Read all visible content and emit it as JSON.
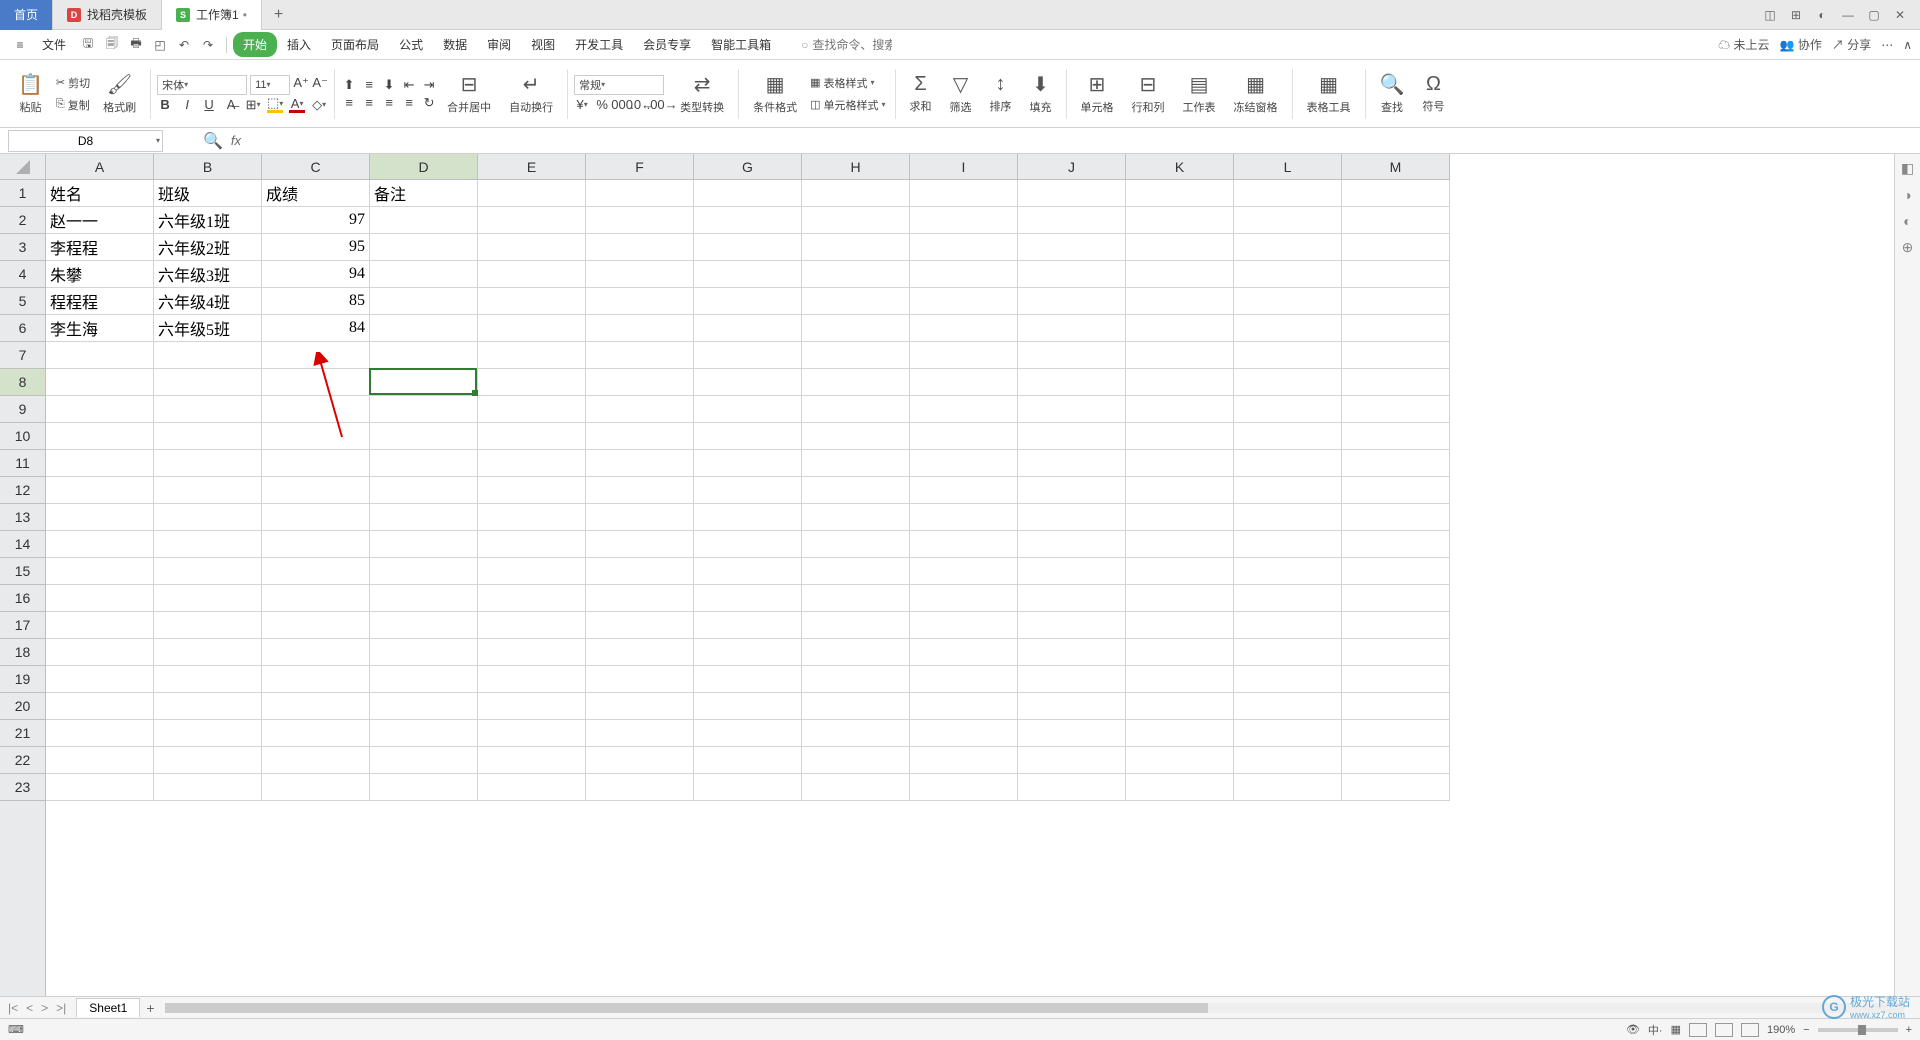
{
  "titlebar": {
    "home_label": "首页",
    "tab1_label": "找稻壳模板",
    "tab2_label": "工作簿1",
    "tab2_modified": "•",
    "add": "+"
  },
  "menubar": {
    "file": "文件",
    "items": [
      "开始",
      "插入",
      "页面布局",
      "公式",
      "数据",
      "审阅",
      "视图",
      "开发工具",
      "会员专享",
      "智能工具箱"
    ],
    "search_placeholder": "查找命令、搜索模板",
    "search_icon": "Q",
    "cloud": "未上云",
    "coop": "协作",
    "share": "分享"
  },
  "ribbon": {
    "paste": "粘贴",
    "cut": "剪切",
    "copy": "复制",
    "format_painter": "格式刷",
    "font_name": "宋体",
    "font_size": "11",
    "merge": "合并居中",
    "wrap": "自动换行",
    "numfmt": "常规",
    "type_convert": "类型转换",
    "cond_fmt": "条件格式",
    "table_style": "表格样式",
    "cell_style": "单元格样式",
    "sum": "求和",
    "filter": "筛选",
    "sort": "排序",
    "fill": "填充",
    "cell": "单元格",
    "rowcol": "行和列",
    "sheet": "工作表",
    "freeze": "冻结窗格",
    "table_tools": "表格工具",
    "find": "查找",
    "symbol": "符号"
  },
  "fbar": {
    "name": "D8",
    "fx": "fx"
  },
  "columns": [
    "A",
    "B",
    "C",
    "D",
    "E",
    "F",
    "G",
    "H",
    "I",
    "J",
    "K",
    "L",
    "M"
  ],
  "rows_count": 23,
  "selected": {
    "col": "D",
    "row": 8,
    "col_index": 3
  },
  "table": {
    "headers": [
      "姓名",
      "班级",
      "成绩",
      "备注"
    ],
    "data": [
      {
        "name": "赵一一",
        "class": "六年级1班",
        "score": 97
      },
      {
        "name": "李程程",
        "class": "六年级2班",
        "score": 95
      },
      {
        "name": "朱攀",
        "class": "六年级3班",
        "score": 94
      },
      {
        "name": "程程程",
        "class": "六年级4班",
        "score": 85
      },
      {
        "name": "李生海",
        "class": "六年级5班",
        "score": 84
      }
    ]
  },
  "sheetbar": {
    "sheet1": "Sheet1",
    "add": "+"
  },
  "statusbar": {
    "zoom": "190%",
    "input_text": "输入",
    "watermark_text": "极光下载站",
    "watermark_url": "www.xz7.com"
  }
}
